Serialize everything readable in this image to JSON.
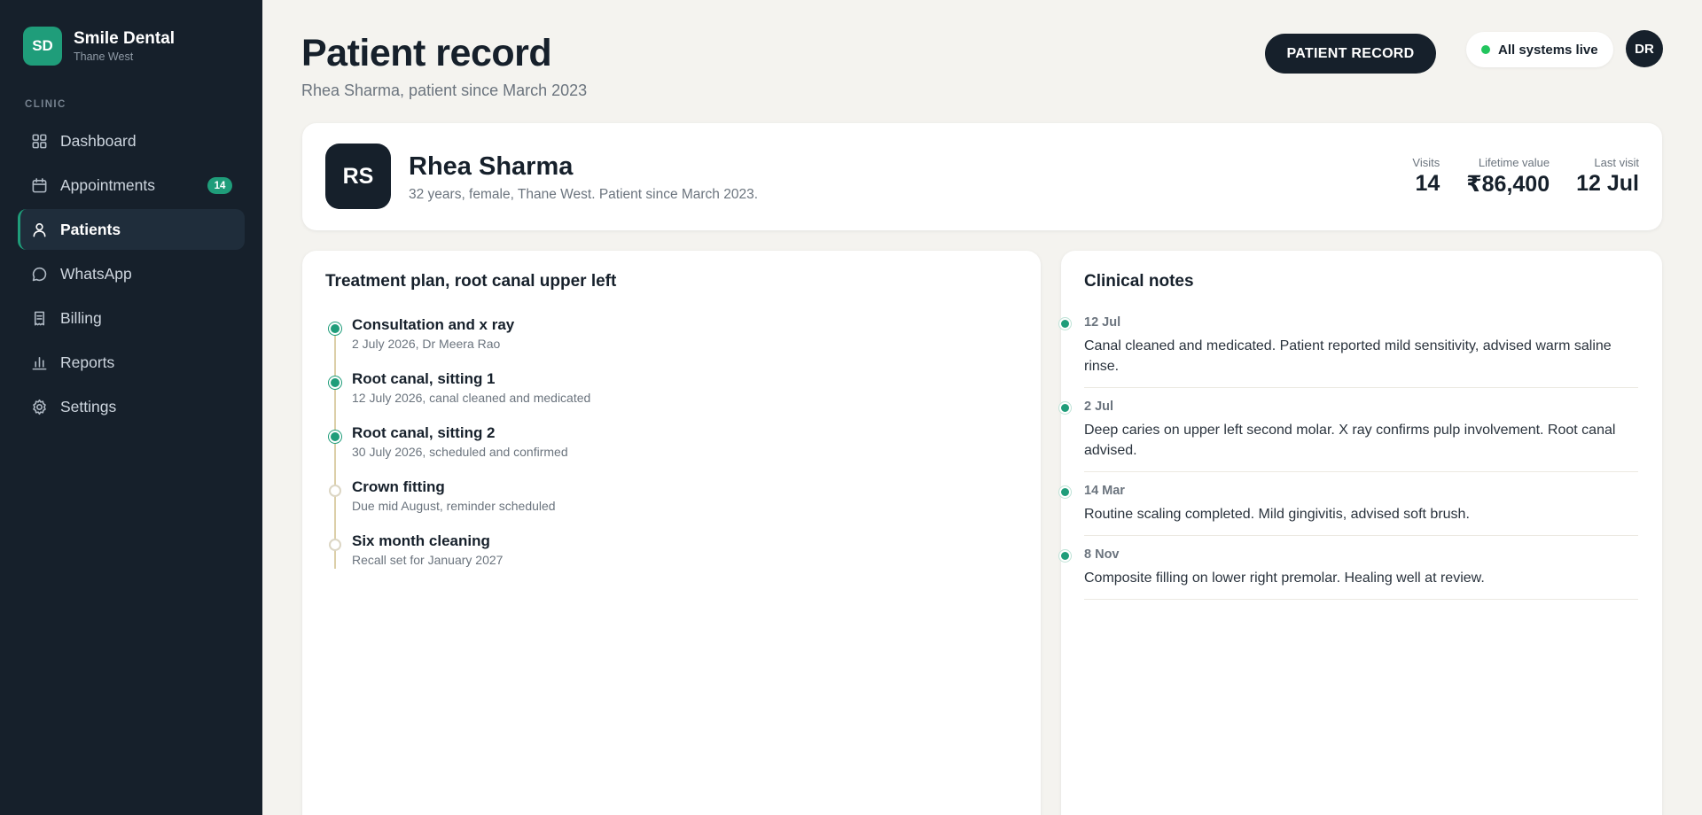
{
  "brand": {
    "logo": "SD",
    "name": "Smile Dental",
    "location": "Thane West",
    "accent": "#1f9d7a"
  },
  "sidebar": {
    "section": "CLINIC",
    "items": [
      {
        "label": "Dashboard",
        "icon": "grid-icon"
      },
      {
        "label": "Appointments",
        "icon": "calendar-icon",
        "badge": "14"
      },
      {
        "label": "Patients",
        "icon": "user-icon",
        "active": true
      },
      {
        "label": "WhatsApp",
        "icon": "chat-icon"
      },
      {
        "label": "Billing",
        "icon": "receipt-icon"
      },
      {
        "label": "Reports",
        "icon": "bar-chart-icon"
      },
      {
        "label": "Settings",
        "icon": "gear-icon"
      }
    ]
  },
  "header": {
    "title": "Patient record",
    "subtitle": "Rhea Sharma, patient since March 2023",
    "record_button": "PATIENT RECORD",
    "status": "All systems live",
    "status_color": "#22c55e",
    "user_initials": "DR"
  },
  "patient": {
    "initials": "RS",
    "name": "Rhea Sharma",
    "meta": "32 years, female, Thane West. Patient since March 2023.",
    "stats": [
      {
        "label": "Visits",
        "value": "14"
      },
      {
        "label": "Lifetime value",
        "value": "₹86,400"
      },
      {
        "label": "Last visit",
        "value": "12 Jul"
      }
    ]
  },
  "plan": {
    "title": "Treatment plan, root canal upper left",
    "steps": [
      {
        "title": "Consultation and x ray",
        "sub": "2 July 2026, Dr Meera Rao",
        "status": "done"
      },
      {
        "title": "Root canal, sitting 1",
        "sub": "12 July 2026, canal cleaned and medicated",
        "status": "done"
      },
      {
        "title": "Root canal, sitting 2",
        "sub": "30 July 2026, scheduled and confirmed",
        "status": "done"
      },
      {
        "title": "Crown fitting",
        "sub": "Due mid August, reminder scheduled",
        "status": "pending"
      },
      {
        "title": "Six month cleaning",
        "sub": "Recall set for January 2027",
        "status": "pending"
      }
    ]
  },
  "notes": {
    "title": "Clinical notes",
    "items": [
      {
        "date": "12 Jul",
        "text": "Canal cleaned and medicated. Patient reported mild sensitivity, advised warm saline rinse."
      },
      {
        "date": "2 Jul",
        "text": "Deep caries on upper left second molar. X ray confirms pulp involvement. Root canal advised."
      },
      {
        "date": "14 Mar",
        "text": "Routine scaling completed. Mild gingivitis, advised soft brush."
      },
      {
        "date": "8 Nov",
        "text": "Composite filling on lower right premolar. Healing well at review."
      }
    ]
  }
}
